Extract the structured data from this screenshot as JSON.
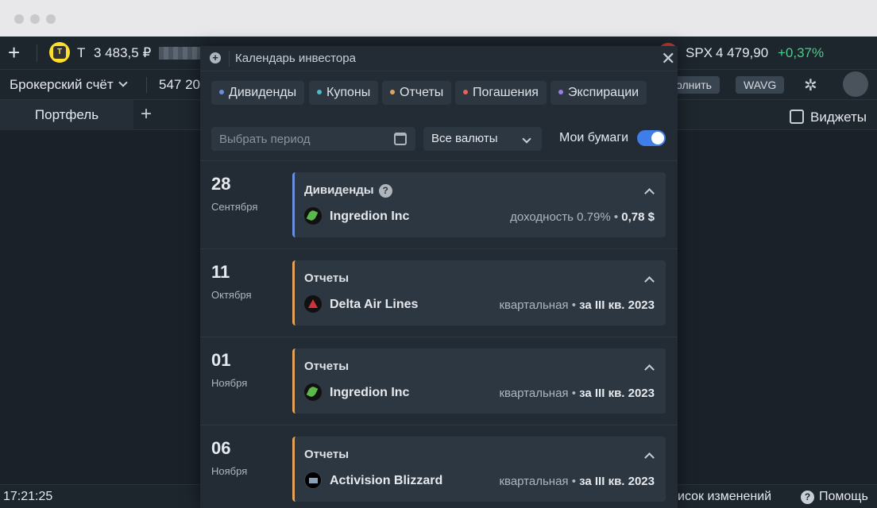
{
  "topbar": {
    "plus_label": "+",
    "broker_letter": "Т",
    "broker_balance": "3 483,5 ₽",
    "index_name": "SPX",
    "index_value": "4 479,90",
    "index_change": "+0,37%"
  },
  "bar2": {
    "account_label": "Брокерский счёт",
    "account_value": "547 20",
    "fill_button": "олнить",
    "wavg_badge": "WAVG"
  },
  "bar3": {
    "portfolio_tab": "Портфель",
    "add_tab": "+",
    "widgets_label": "Виджеты"
  },
  "statusbar": {
    "time": "17:21:25",
    "changes_label": "исок изменений",
    "help_label": "Помощь"
  },
  "panel": {
    "title": "Календарь инвестора",
    "close_label": "✕",
    "filters": [
      {
        "label": "Дивиденды",
        "color": "#6b8ee0"
      },
      {
        "label": "Купоны",
        "color": "#4fb9c4"
      },
      {
        "label": "Отчеты",
        "color": "#e4a35a"
      },
      {
        "label": "Погашения",
        "color": "#e5625a"
      },
      {
        "label": "Экспирации",
        "color": "#9b7ce8"
      }
    ],
    "period_placeholder": "Выбрать период",
    "currency_value": "Все валюты",
    "my_securities_label": "Мои бумаги",
    "my_securities_on": true,
    "events": [
      {
        "day": "28",
        "month": "Сентября",
        "type": "Дивиденды",
        "company": "Ingredion Inc",
        "detail_muted": "доходность 0.79% • ",
        "detail_bold": "0,78 $"
      },
      {
        "day": "11",
        "month": "Октября",
        "type": "Отчеты",
        "company": "Delta Air Lines",
        "detail_muted": "квартальная • ",
        "detail_bold": "за III кв. 2023"
      },
      {
        "day": "01",
        "month": "Ноября",
        "type": "Отчеты",
        "company": "Ingredion Inc",
        "detail_muted": "квартальная • ",
        "detail_bold": "за III кв. 2023"
      },
      {
        "day": "06",
        "month": "Ноября",
        "type": "Отчеты",
        "company": "Activision Blizzard",
        "detail_muted": "квартальная • ",
        "detail_bold": "за III кв. 2023"
      }
    ]
  }
}
